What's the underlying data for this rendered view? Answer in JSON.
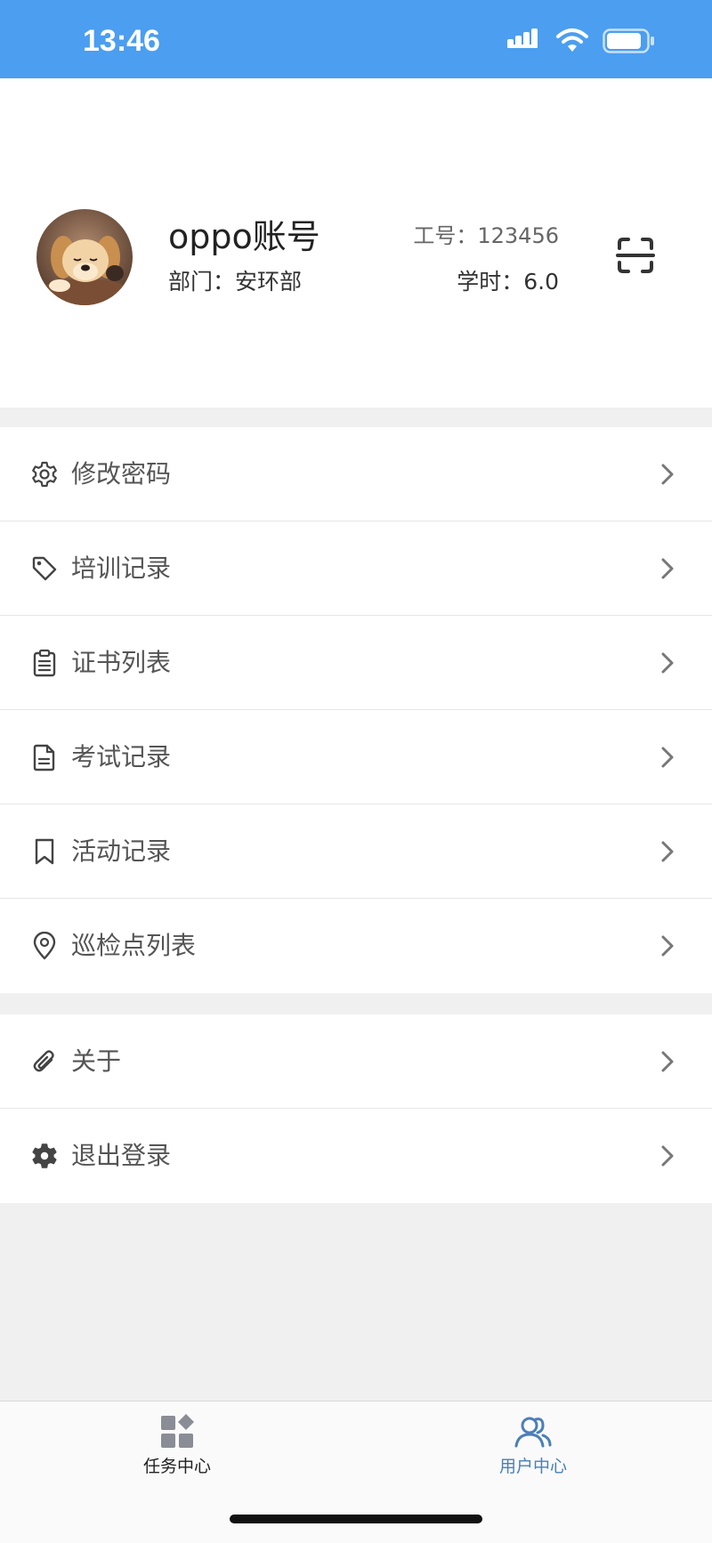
{
  "status_bar": {
    "time": "13:46",
    "icons": [
      "signal-icon",
      "wifi-icon",
      "battery-icon"
    ],
    "color": "#4b9ef0"
  },
  "profile": {
    "name": "oppo账号",
    "department": "部门：安环部",
    "employee_id": "工号：123456",
    "study_hours": "学时：6.0",
    "avatar": "puppy-avatar",
    "scan_icon": "scan-icon"
  },
  "menu_primary": [
    {
      "label": "修改密码",
      "icon": "gear-outline-icon"
    },
    {
      "label": "培训记录",
      "icon": "tag-icon"
    },
    {
      "label": "证书列表",
      "icon": "clipboard-list-icon"
    },
    {
      "label": "考试记录",
      "icon": "document-icon"
    },
    {
      "label": "活动记录",
      "icon": "bookmark-icon"
    },
    {
      "label": "巡检点列表",
      "icon": "location-pin-icon"
    }
  ],
  "menu_secondary": [
    {
      "label": "关于",
      "icon": "paperclip-icon"
    },
    {
      "label": "退出登录",
      "icon": "gear-filled-icon"
    }
  ],
  "tab_bar": {
    "tabs": [
      {
        "label": "任务中心",
        "icon": "apps-grid-icon",
        "active": false
      },
      {
        "label": "用户中心",
        "icon": "users-icon",
        "active": true
      }
    ],
    "active_color": "#4a7fb8"
  }
}
